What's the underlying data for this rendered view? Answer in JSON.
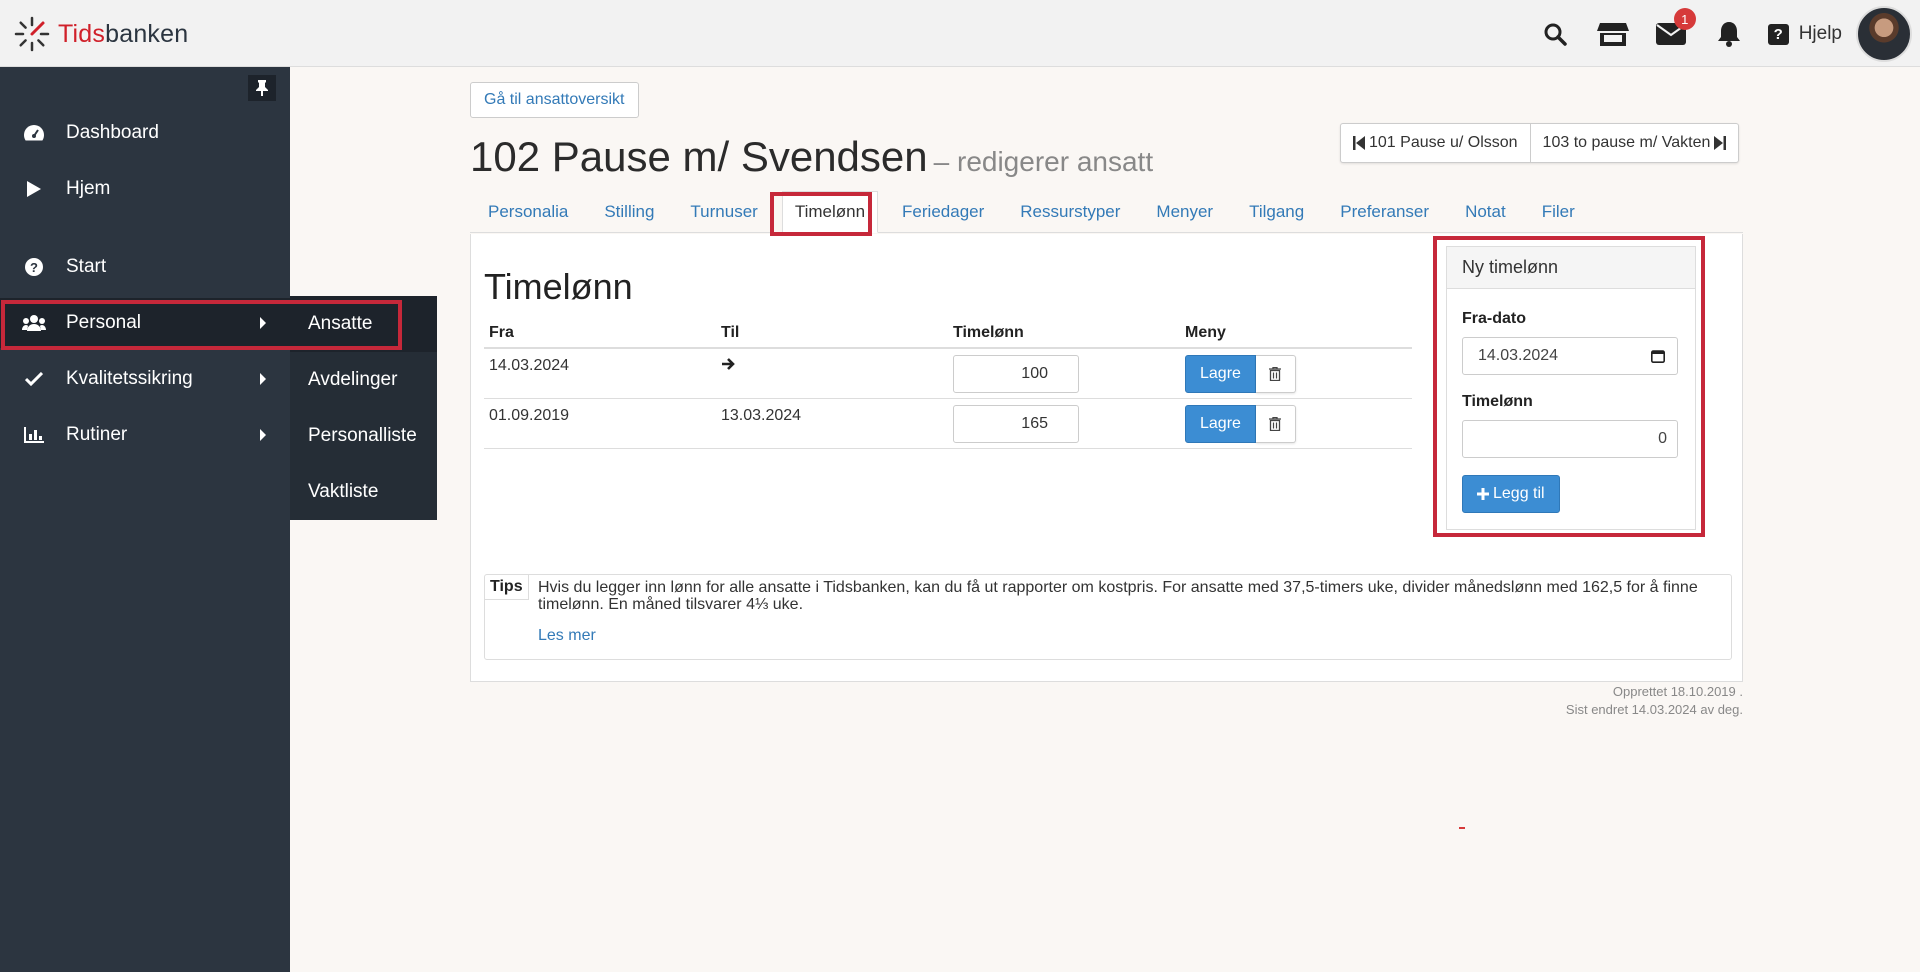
{
  "app": {
    "logo_red": "Tids",
    "logo_dark": "banken",
    "help_label": "Hjelp",
    "mail_badge": "1",
    "icons": [
      "search-icon",
      "store-icon",
      "mail-icon",
      "bell-icon",
      "help-icon"
    ]
  },
  "sidebar": {
    "items": [
      {
        "label": "Dashboard",
        "icon": "dashboard-icon"
      },
      {
        "label": "Hjem",
        "icon": "play-icon"
      },
      {
        "label": "Start",
        "icon": "question-circle-icon"
      },
      {
        "label": "Personal",
        "icon": "users-icon"
      },
      {
        "label": "Kvalitetssikring",
        "icon": "check-icon"
      },
      {
        "label": "Rutiner",
        "icon": "bar-chart-icon"
      }
    ],
    "submenu": [
      "Ansatte",
      "Avdelinger",
      "Personalliste",
      "Vaktliste"
    ]
  },
  "main": {
    "overview_button": "Gå til ansattoversikt",
    "title": "102 Pause m/ Svendsen",
    "subtitle": "– redigerer ansatt",
    "prev_employee": "101 Pause u/ Olsson",
    "next_employee": "103 to pause m/ Vakten",
    "tabs": [
      "Personalia",
      "Stilling",
      "Turnuser",
      "Timelønn",
      "Feriedager",
      "Ressurstyper",
      "Menyer",
      "Tilgang",
      "Preferanser",
      "Notat",
      "Filer"
    ],
    "active_tab": "Timelønn",
    "section_title": "Timelønn",
    "table": {
      "headers": [
        "Fra",
        "Til",
        "Timelønn",
        "Meny"
      ],
      "rows": [
        {
          "fra": "14.03.2024",
          "til": "",
          "wage": "100"
        },
        {
          "fra": "01.09.2019",
          "til": "13.03.2024",
          "wage": "165"
        }
      ],
      "save_label": "Lagre"
    },
    "tips": {
      "label": "Tips",
      "text": "Hvis du legger inn lønn for alle ansatte i Tidsbanken, kan du få ut rapporter om kostpris. For ansatte med 37,5-timers uke, divider månedslønn med 162,5 for å finne timelønn. En måned tilsvarer 4⅓ uke.",
      "more": "Les mer"
    },
    "new_wage": {
      "title": "Ny timelønn",
      "date_label": "Fra-dato",
      "date_value": "14.03.2024",
      "wage_label": "Timelønn",
      "wage_value": "0",
      "add_button": "Legg til"
    },
    "meta": {
      "created": "Opprettet 18.10.2019 .",
      "changed": "Sist endret 14.03.2024 av deg."
    }
  },
  "colors": {
    "sidebar": "#2c3540",
    "accent": "#337ab7",
    "primary_button": "#3c8dd3",
    "highlight": "#c6283a"
  }
}
